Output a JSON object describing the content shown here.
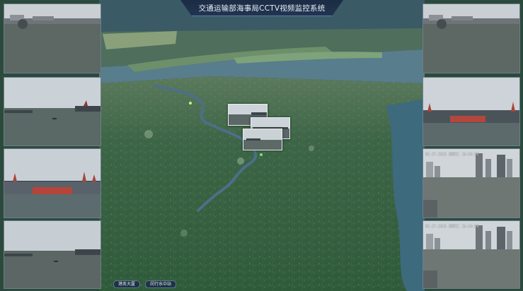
{
  "title": "交通运输部海事局CCTV视频监控系统",
  "colors": {
    "accent": "#5f7fa8",
    "river": "#4d6f88",
    "map_green": "#3f6a48",
    "marker": "#9ef07a"
  },
  "map": {
    "stations": [
      {
        "id": "site-1",
        "label": "港务大厦"
      },
      {
        "id": "site-2",
        "label": "闵行水中站"
      }
    ]
  },
  "right_feeds": {
    "feed3": {
      "osd": "02-27-2015 星期三 16:40:35"
    },
    "feed4": {
      "osd": "02-27-2015 星期三 16:40:59"
    }
  }
}
